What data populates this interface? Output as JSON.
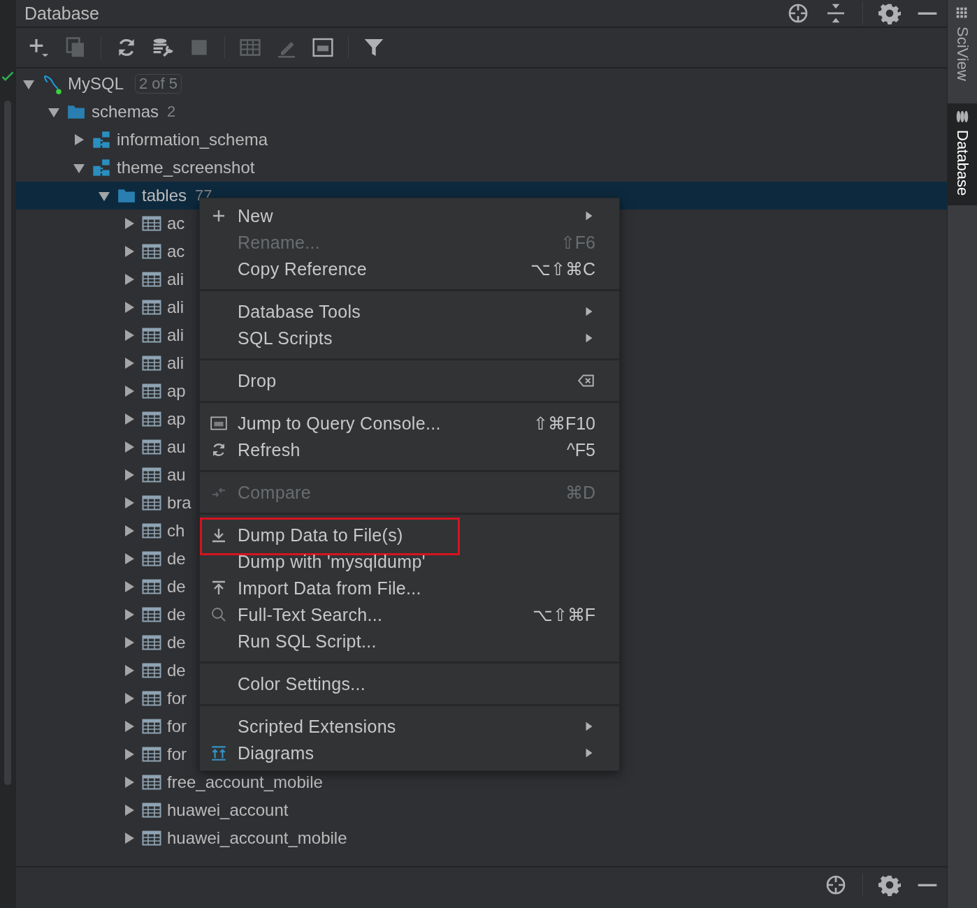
{
  "panel": {
    "title": "Database"
  },
  "tree": [
    {
      "label": "MySQL",
      "badge": "2 of 5",
      "kind": "datasource",
      "expanded": true,
      "selected": false,
      "children": [
        {
          "label": "schemas",
          "count": "2",
          "kind": "folder",
          "expanded": true,
          "selected": false,
          "children": [
            {
              "label": "information_schema",
              "kind": "schema",
              "expanded": false,
              "selected": false
            },
            {
              "label": "theme_screenshot",
              "kind": "schema",
              "expanded": true,
              "selected": false,
              "children": [
                {
                  "label": "tables",
                  "count": "77",
                  "kind": "folder",
                  "expanded": true,
                  "selected": true,
                  "children": [
                    {
                      "label": "ac",
                      "kind": "table",
                      "expanded": false,
                      "selected": false
                    },
                    {
                      "label": "ac",
                      "kind": "table",
                      "expanded": false,
                      "selected": false
                    },
                    {
                      "label": "ali",
                      "kind": "table",
                      "expanded": false,
                      "selected": false
                    },
                    {
                      "label": "ali",
                      "kind": "table",
                      "expanded": false,
                      "selected": false
                    },
                    {
                      "label": "ali",
                      "kind": "table",
                      "expanded": false,
                      "selected": false
                    },
                    {
                      "label": "ali",
                      "kind": "table",
                      "expanded": false,
                      "selected": false
                    },
                    {
                      "label": "ap",
                      "kind": "table",
                      "expanded": false,
                      "selected": false
                    },
                    {
                      "label": "ap",
                      "kind": "table",
                      "expanded": false,
                      "selected": false
                    },
                    {
                      "label": "au",
                      "kind": "table",
                      "expanded": false,
                      "selected": false
                    },
                    {
                      "label": "au",
                      "kind": "table",
                      "expanded": false,
                      "selected": false
                    },
                    {
                      "label": "bra",
                      "kind": "table",
                      "expanded": false,
                      "selected": false
                    },
                    {
                      "label": "ch",
                      "kind": "table",
                      "expanded": false,
                      "selected": false
                    },
                    {
                      "label": "de",
                      "kind": "table",
                      "expanded": false,
                      "selected": false
                    },
                    {
                      "label": "de",
                      "kind": "table",
                      "expanded": false,
                      "selected": false
                    },
                    {
                      "label": "de",
                      "kind": "table",
                      "expanded": false,
                      "selected": false
                    },
                    {
                      "label": "de",
                      "kind": "table",
                      "expanded": false,
                      "selected": false
                    },
                    {
                      "label": "de",
                      "kind": "table",
                      "expanded": false,
                      "selected": false
                    },
                    {
                      "label": "for",
                      "kind": "table",
                      "expanded": false,
                      "selected": false
                    },
                    {
                      "label": "for",
                      "kind": "table",
                      "expanded": false,
                      "selected": false
                    },
                    {
                      "label": "for",
                      "kind": "table",
                      "expanded": false,
                      "selected": false
                    },
                    {
                      "label": "free_account_mobile",
                      "kind": "table",
                      "expanded": false,
                      "selected": false
                    },
                    {
                      "label": "huawei_account",
                      "kind": "table",
                      "expanded": false,
                      "selected": false
                    },
                    {
                      "label": "huawei_account_mobile",
                      "kind": "table",
                      "expanded": false,
                      "selected": false
                    }
                  ]
                }
              ]
            }
          ]
        }
      ]
    }
  ],
  "context_menu": {
    "groups": [
      [
        {
          "label": "New",
          "submenu": true,
          "disabled": false,
          "highlighted": false
        },
        {
          "label": "Rename...",
          "shortcut": "⇧F6",
          "submenu": false,
          "disabled": true,
          "highlighted": false
        },
        {
          "label": "Copy Reference",
          "shortcut": "⌥⇧⌘C",
          "submenu": false,
          "disabled": false,
          "highlighted": false
        }
      ],
      [
        {
          "label": "Database Tools",
          "submenu": true,
          "disabled": false,
          "highlighted": false
        },
        {
          "label": "SQL Scripts",
          "submenu": true,
          "disabled": false,
          "highlighted": false
        }
      ],
      [
        {
          "label": "Drop",
          "submenu": false,
          "disabled": false,
          "highlighted": false
        }
      ],
      [
        {
          "label": "Jump to Query Console...",
          "shortcut": "⇧⌘F10",
          "submenu": false,
          "disabled": false,
          "highlighted": false
        },
        {
          "label": "Refresh",
          "shortcut": "^F5",
          "submenu": false,
          "disabled": false,
          "highlighted": false
        }
      ],
      [
        {
          "label": "Compare",
          "shortcut": "⌘D",
          "submenu": false,
          "disabled": true,
          "highlighted": false
        }
      ],
      [
        {
          "label": "Dump Data to File(s)",
          "submenu": false,
          "disabled": false,
          "highlighted": true
        },
        {
          "label": "Dump with 'mysqldump'",
          "submenu": false,
          "disabled": false,
          "highlighted": false
        },
        {
          "label": "Import Data from File...",
          "submenu": false,
          "disabled": false,
          "highlighted": false
        },
        {
          "label": "Full-Text Search...",
          "shortcut": "⌥⇧⌘F",
          "submenu": false,
          "disabled": false,
          "highlighted": false
        },
        {
          "label": "Run SQL Script...",
          "submenu": false,
          "disabled": false,
          "highlighted": false
        }
      ],
      [
        {
          "label": "Color Settings...",
          "submenu": false,
          "disabled": false,
          "highlighted": false
        }
      ],
      [
        {
          "label": "Scripted Extensions",
          "submenu": true,
          "disabled": false,
          "highlighted": false
        },
        {
          "label": "Diagrams",
          "submenu": true,
          "disabled": false,
          "highlighted": false
        }
      ]
    ]
  },
  "side_tabs": [
    {
      "label": "SciView",
      "selected": false
    },
    {
      "label": "Database",
      "selected": true
    }
  ]
}
